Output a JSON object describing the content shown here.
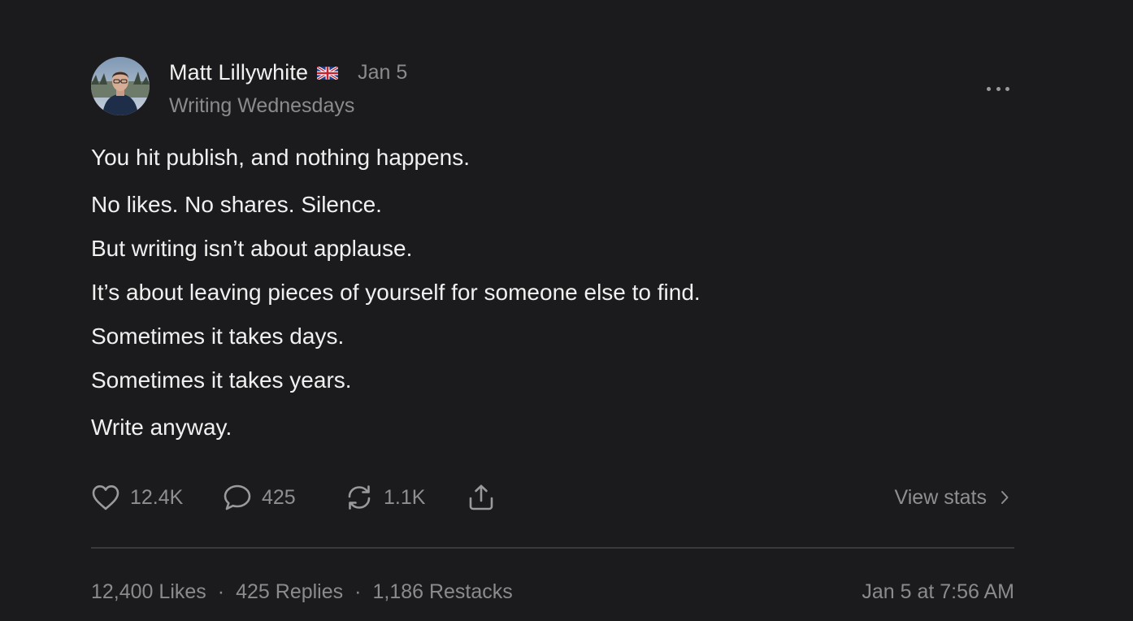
{
  "post": {
    "author": {
      "name": "Matt Lillywhite",
      "flag_icon": "uk-flag-icon",
      "avatar_icon": "avatar-photo"
    },
    "date": "Jan 5",
    "publication": "Writing Wednesdays",
    "more_icon": "more-horizontal-icon",
    "body": [
      "You hit publish, and nothing happens.",
      "No likes. No shares. Silence.",
      "But writing isn’t about applause.",
      "It’s about leaving pieces of yourself for someone else to find.",
      "Sometimes it takes days.",
      "Sometimes it takes years.",
      "Write anyway."
    ],
    "actions": {
      "like": {
        "icon": "heart-icon",
        "count": "12.4K"
      },
      "reply": {
        "icon": "comment-icon",
        "count": "425"
      },
      "restack": {
        "icon": "restack-icon",
        "count": "1.1K"
      },
      "share": {
        "icon": "share-icon"
      },
      "view_stats": "View stats"
    },
    "footer": {
      "likes": "12,400 Likes",
      "replies": "425 Replies",
      "restacks": "1,186 Restacks",
      "separator": "·",
      "timestamp": "Jan 5 at 7:56 AM"
    }
  },
  "colors": {
    "background": "#1b1b1d",
    "primary_text": "#f0f0f0",
    "secondary_text": "#8b8b8e",
    "divider": "#3a3a3d"
  }
}
